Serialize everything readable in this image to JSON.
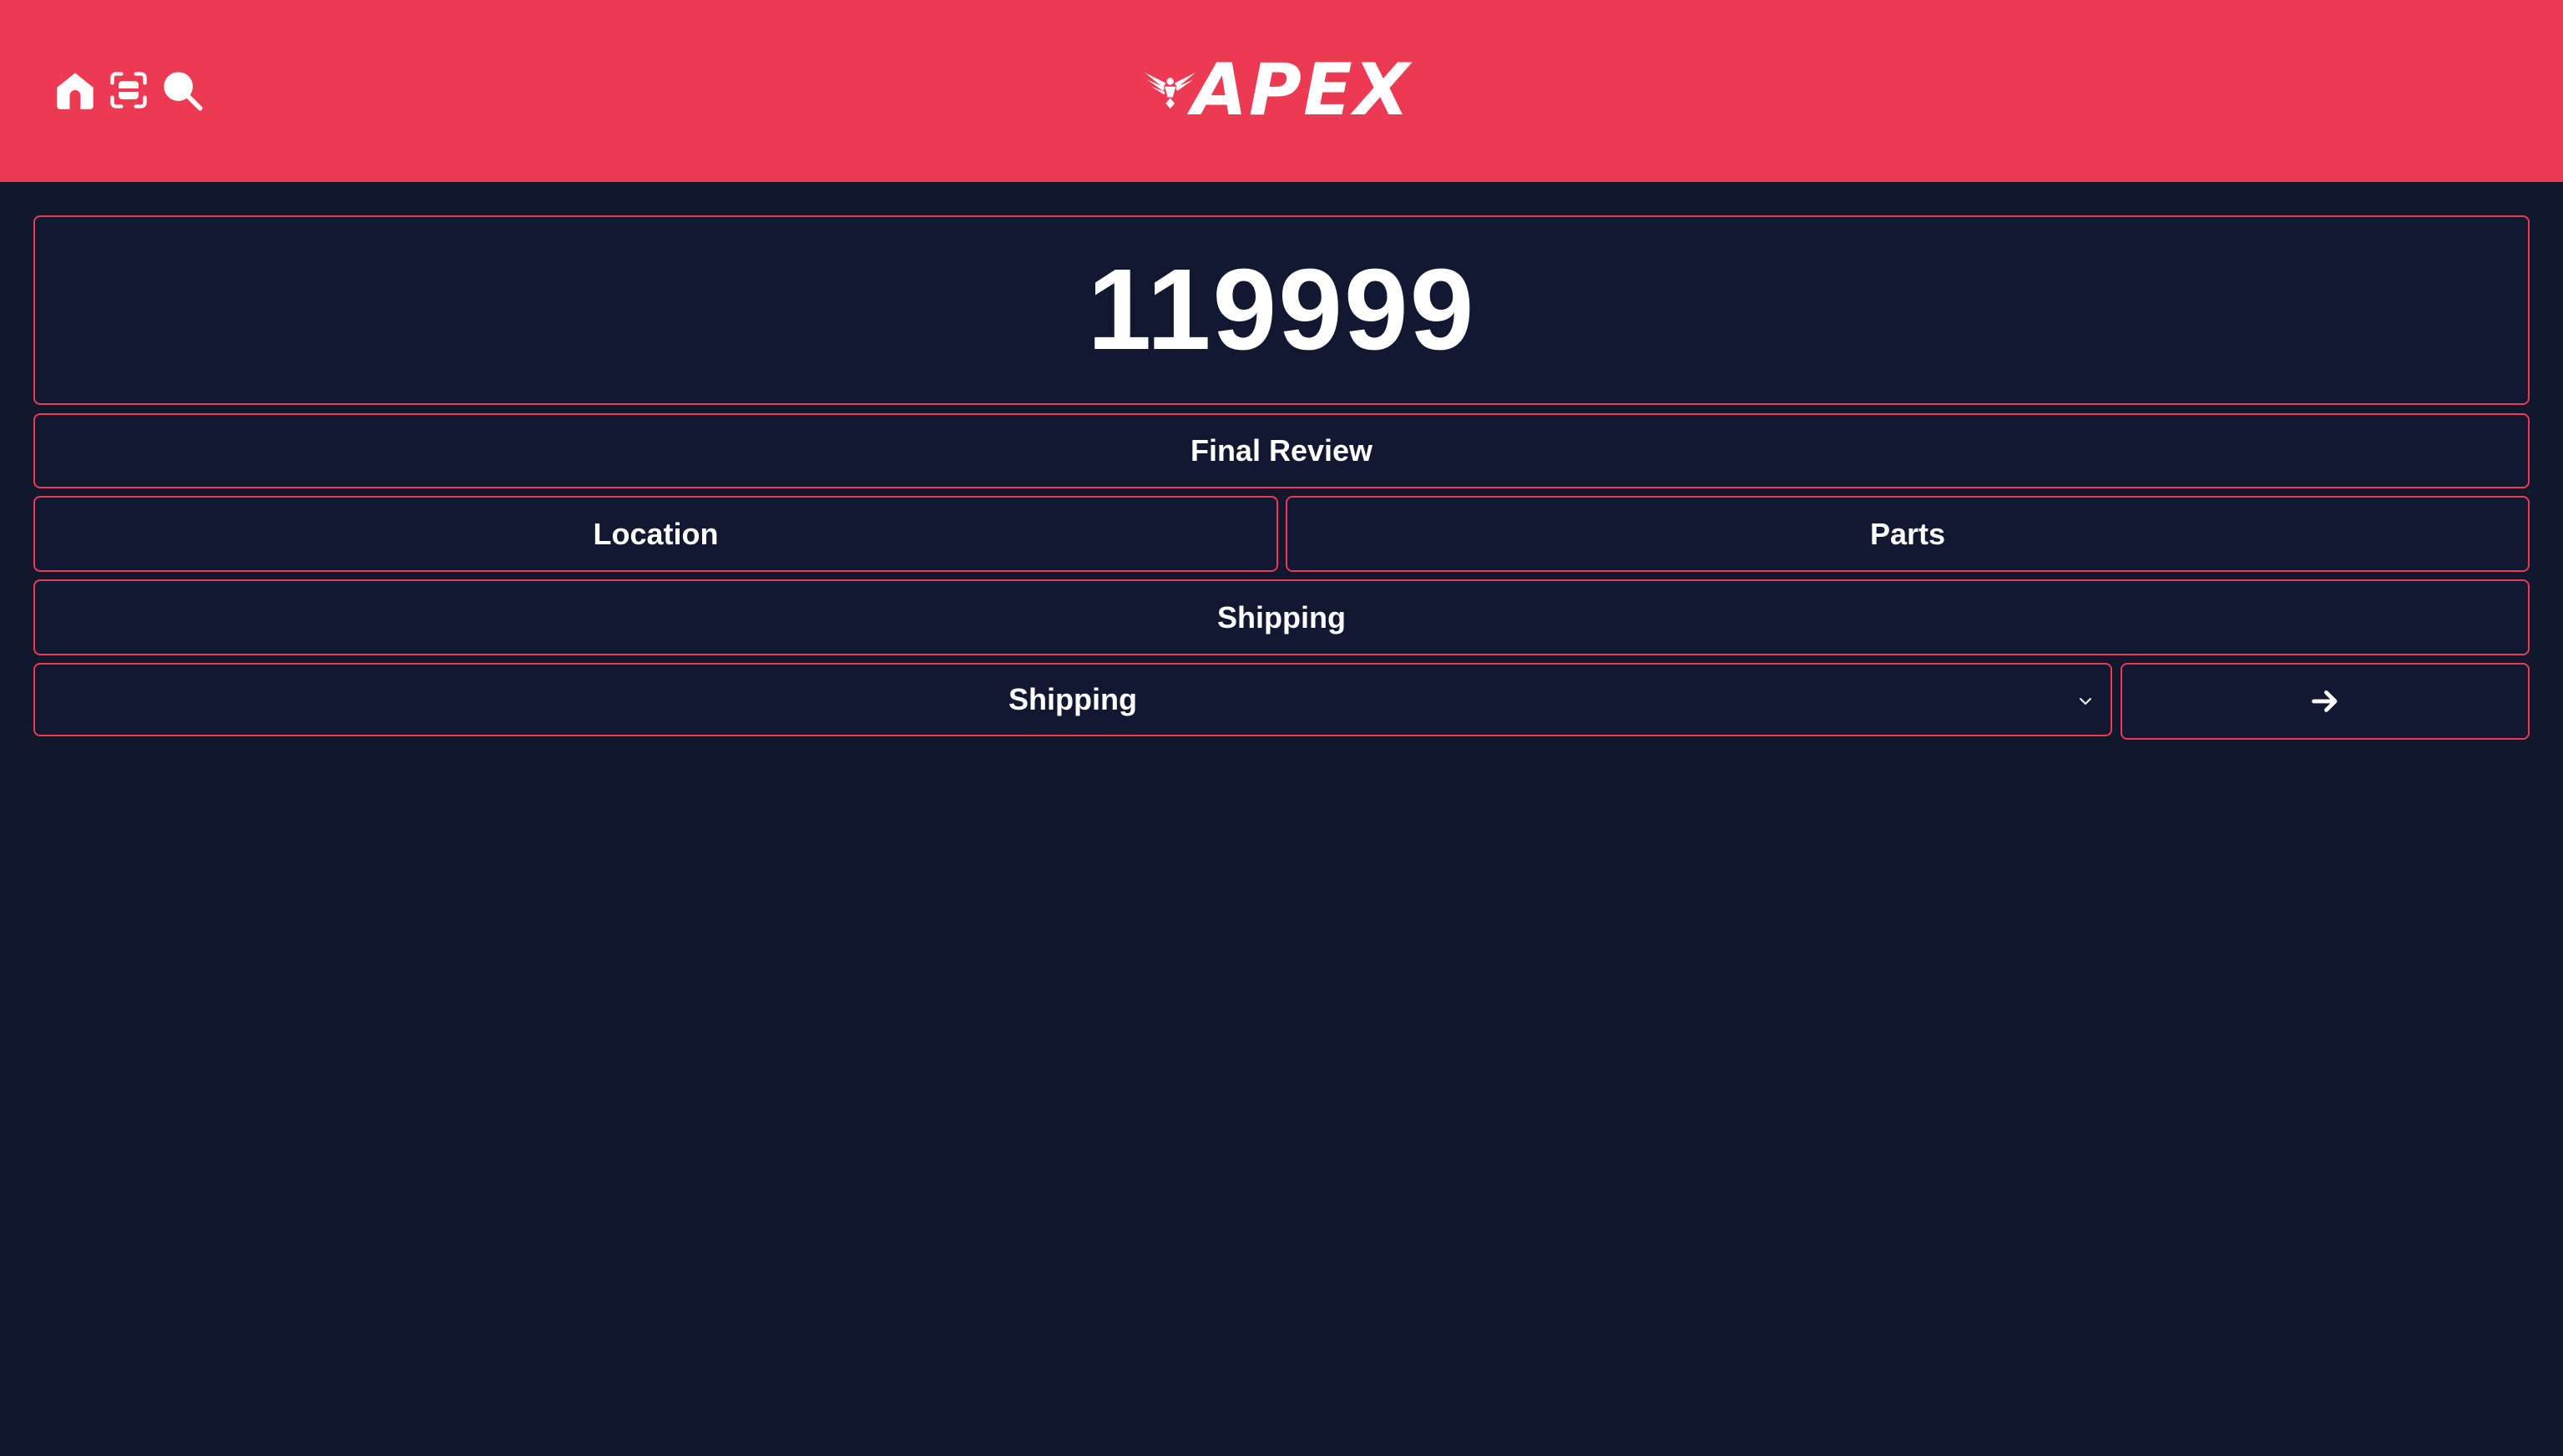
{
  "header": {
    "logo_text": "APEX",
    "icons": [
      "home-icon",
      "scan-icon",
      "search-icon"
    ],
    "background_color": "#eb3a52"
  },
  "order": {
    "number": "119999"
  },
  "actions": {
    "final_review": "Final Review",
    "location": "Location",
    "parts": "Parts",
    "shipping": "Shipping"
  },
  "status_select": {
    "selected": "Shipping",
    "submit_icon": "arrow-right-icon"
  },
  "colors": {
    "background": "#11172c",
    "accent": "#eb3a52",
    "text": "#ffffff"
  }
}
